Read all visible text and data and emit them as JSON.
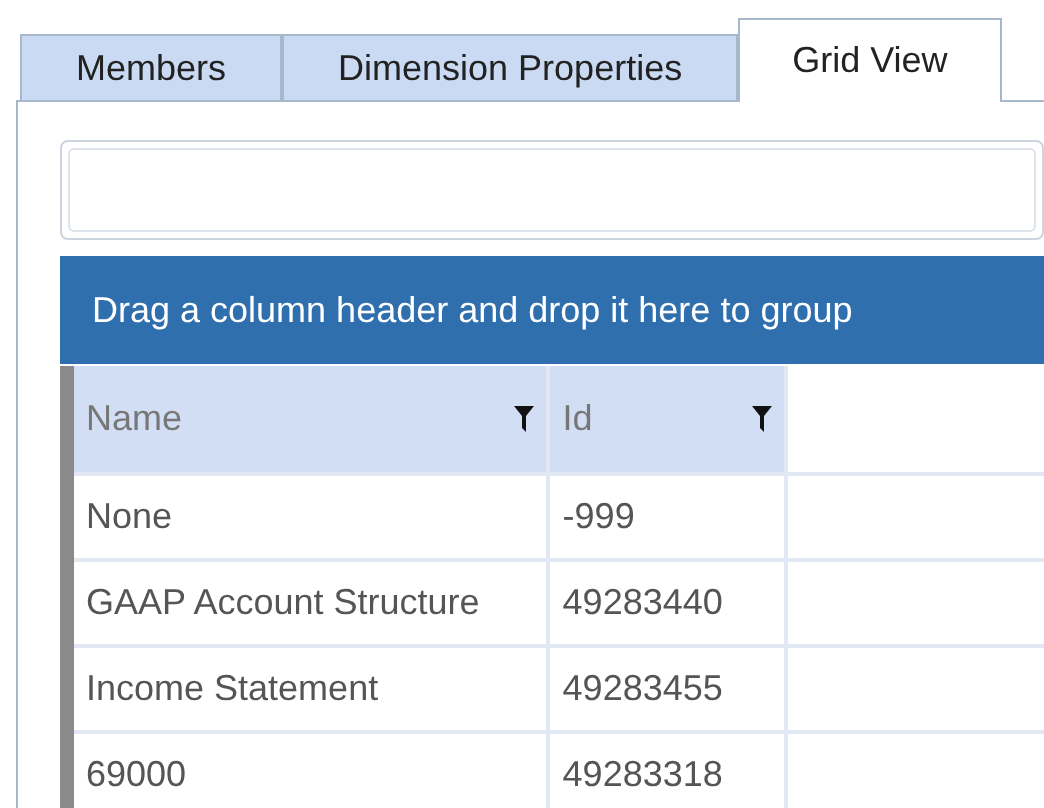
{
  "tabs": [
    {
      "label": "Members",
      "selected": false
    },
    {
      "label": "Dimension Properties",
      "selected": false
    },
    {
      "label": "Grid View",
      "selected": true
    }
  ],
  "group_panel": {
    "text": "Drag a column header and drop it here to group"
  },
  "table": {
    "columns": [
      {
        "label": "Name",
        "filter": true
      },
      {
        "label": "Id",
        "filter": true
      }
    ],
    "rows": [
      [
        "None",
        "-999"
      ],
      [
        "GAAP Account Structure",
        "49283440"
      ],
      [
        "Income Statement",
        "49283455"
      ],
      [
        "69000",
        "49283318"
      ]
    ]
  }
}
